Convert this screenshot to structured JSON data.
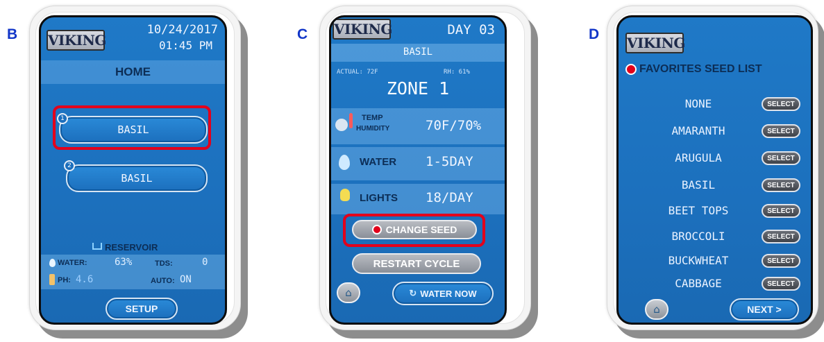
{
  "panels": {
    "b": {
      "letter": "B",
      "logo": "VIKING",
      "date": "10/24/2017",
      "time": "01:45 PM",
      "title": "HOME",
      "slots": [
        {
          "number": "1",
          "label": "BASIL"
        },
        {
          "number": "2",
          "label": "BASIL"
        }
      ],
      "reservoir_title": "RESERVOIR",
      "water_label": "WATER:",
      "water_value": "63%",
      "tds_label": "TDS:",
      "tds_value": "0",
      "ph_label": "PH:",
      "ph_value": "4.6",
      "auto_label": "AUTO:",
      "auto_value": "ON",
      "setup_label": "SETUP"
    },
    "c": {
      "letter": "C",
      "logo": "VIKING",
      "day": "DAY 03",
      "seed": "BASIL",
      "actual": "ACTUAL: 72F",
      "rh": "RH: 61%",
      "zone": "ZONE 1",
      "temp_label": "TEMP",
      "humidity_label": "HUMIDITY",
      "temp_value": "70F/70%",
      "water_label": "WATER",
      "water_value": "1-5DAY",
      "lights_label": "LIGHTS",
      "lights_value": "18/DAY",
      "change_seed": "CHANGE SEED",
      "restart_cycle": "RESTART CYCLE",
      "water_now": "WATER NOW"
    },
    "d": {
      "letter": "D",
      "logo": "VIKING",
      "title": "FAVORITES SEED LIST",
      "select_label": "SELECT",
      "seeds": [
        "NONE",
        "AMARANTH",
        "ARUGULA",
        "BASIL",
        "BEET TOPS",
        "BROCCOLI",
        "BUCKWHEAT",
        "CABBAGE"
      ],
      "next_label": "NEXT >"
    }
  },
  "colors": {
    "screen_blue": "#1f79c7",
    "highlight_red": "#e3001b",
    "panel_letter": "#1236c8"
  }
}
